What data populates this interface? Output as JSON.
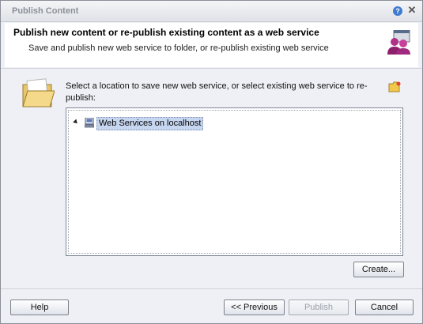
{
  "window": {
    "title": "Publish Content",
    "help_glyph": "?",
    "close_glyph": "✕"
  },
  "header": {
    "title": "Publish new content or re-publish existing content as a web service",
    "subtitle": "Save and publish new web service to folder, or re-publish existing web service",
    "icon": "users-icon"
  },
  "body": {
    "instruction": "Select a location to save new web service, or select existing web service to re-publish:",
    "folder_icon": "folder-icon",
    "new_folder_icon": "new-folder-icon",
    "tree": {
      "nodes": [
        {
          "label": "Web Services on localhost",
          "icon": "server-icon",
          "expanded": true,
          "selected": true
        }
      ]
    },
    "create_label": "Create..."
  },
  "footer": {
    "help_label": "Help",
    "previous_label": "<< Previous",
    "publish_label": "Publish",
    "publish_enabled": false,
    "cancel_label": "Cancel"
  },
  "colors": {
    "dialog_bg": "#eef0f5",
    "header_bg": "#ffffff",
    "selection_bg": "#c7d6f0",
    "title_text": "#8c9099"
  }
}
